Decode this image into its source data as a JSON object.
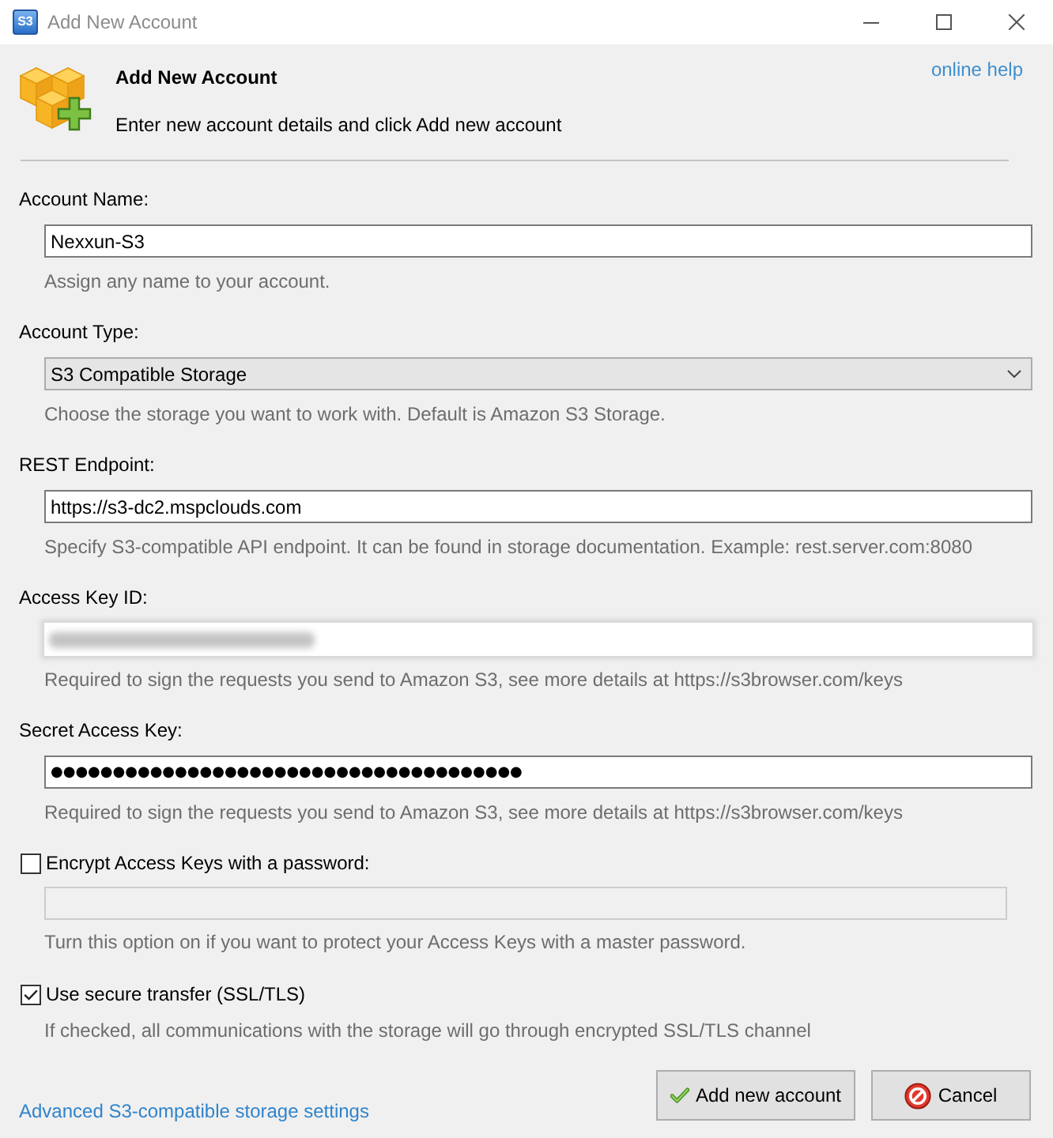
{
  "window": {
    "title": "Add New Account",
    "icon_text": "S3"
  },
  "header": {
    "title": "Add New Account",
    "subtitle": "Enter new account details and click Add new account",
    "help_link": "online help"
  },
  "fields": [
    {
      "kind": "text",
      "label": "Account Name:",
      "value": "Nexxun-S3",
      "hint": "Assign any name to your account."
    },
    {
      "kind": "dropdown",
      "label": "Account Type:",
      "value": "S3 Compatible Storage",
      "hint": "Choose the storage you want to work with. Default is Amazon S3 Storage."
    },
    {
      "kind": "text",
      "label": "REST Endpoint:",
      "value": "https://s3-dc2.mspclouds.com",
      "hint": "Specify S3-compatible API endpoint. It can be found in storage documentation. Example: rest.server.com:8080"
    },
    {
      "kind": "redacted",
      "label": "Access Key ID:",
      "hint": "Required to sign the requests you send to Amazon S3, see more details at https://s3browser.com/keys"
    },
    {
      "kind": "password",
      "label": "Secret Access Key:",
      "value": "●●●●●●●●●●●●●●●●●●●●●●●●●●●●●●●●●●●●●●",
      "hint": "Required to sign the requests you send to Amazon S3, see more details at https://s3browser.com/keys"
    }
  ],
  "options": [
    {
      "label": "Encrypt Access Keys with a password:",
      "checked": false,
      "password_field": {
        "disabled": true
      },
      "hint": "Turn this option on if you want to protect your Access Keys with a master password."
    },
    {
      "label": "Use secure transfer (SSL/TLS)",
      "checked": true,
      "hint": "If checked, all communications with the storage will go through encrypted SSL/TLS channel"
    }
  ],
  "footer": {
    "link": "Advanced S3-compatible storage settings",
    "buttons": [
      {
        "kind": "confirm",
        "label": "Add new account"
      },
      {
        "kind": "cancel",
        "label": "Cancel"
      }
    ]
  }
}
